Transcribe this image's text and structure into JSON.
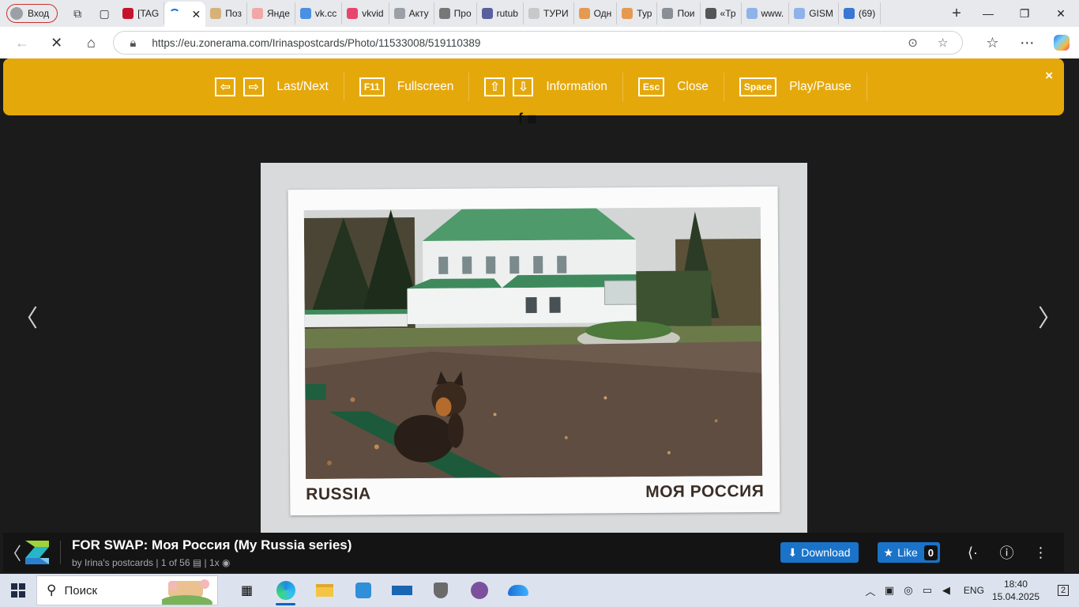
{
  "browser": {
    "profile_label": "Вход",
    "tabs": [
      {
        "title": "[TAG",
        "color": "#c4142c"
      },
      {
        "title": "Поз",
        "color": "#d6b27a"
      },
      {
        "title": "Янде",
        "color": "#f2a7a7"
      },
      {
        "title": "vk.cc",
        "color": "#4a90e2"
      },
      {
        "title": "vkvid",
        "color": "#e8456e"
      },
      {
        "title": "Акту",
        "color": "#9aa0a6"
      },
      {
        "title": "Про",
        "color": "#777777"
      },
      {
        "title": "rutub",
        "color": "#5a5f9e"
      },
      {
        "title": "ТУРИ",
        "color": "#c8c8c8"
      },
      {
        "title": "Одн",
        "color": "#e59a52"
      },
      {
        "title": "Тур",
        "color": "#e59a52"
      },
      {
        "title": "Пои",
        "color": "#8a8f96"
      },
      {
        "title": "«Тр",
        "color": "#555555"
      },
      {
        "title": "www.",
        "color": "#8fb2e8"
      },
      {
        "title": "GISM",
        "color": "#8fb2e8"
      },
      {
        "title": "(69)",
        "color": "#3a78d4"
      }
    ],
    "url": "https://eu.zonerama.com/Irinaspostcards/Photo/11533008/519110389"
  },
  "helpbar": {
    "groups": [
      {
        "keys": [
          "⇦",
          "⇨"
        ],
        "label": "Last/Next"
      },
      {
        "keys": [
          "F11"
        ],
        "label": "Fullscreen"
      },
      {
        "keys": [
          "⇧",
          "⇩"
        ],
        "label": "Information"
      },
      {
        "keys": [
          "Esc"
        ],
        "label": "Close"
      },
      {
        "keys": [
          "Space"
        ],
        "label": "Play/Pause"
      }
    ],
    "close_symbol": "×"
  },
  "photo": {
    "caption_left": "RUSSIA",
    "caption_right": "МОЯ РОССИЯ"
  },
  "info": {
    "title": "FOR SWAP: Моя Россия (My Russia series)",
    "byline": "by Irina's postcards",
    "position": "1 of 56",
    "views": "1x",
    "download_label": "Download",
    "like_label": "Like",
    "like_count": "0"
  },
  "taskbar": {
    "search_placeholder": "Поиск",
    "language": "ENG",
    "time": "18:40",
    "date": "15.04.2025",
    "notification_count": "2"
  }
}
